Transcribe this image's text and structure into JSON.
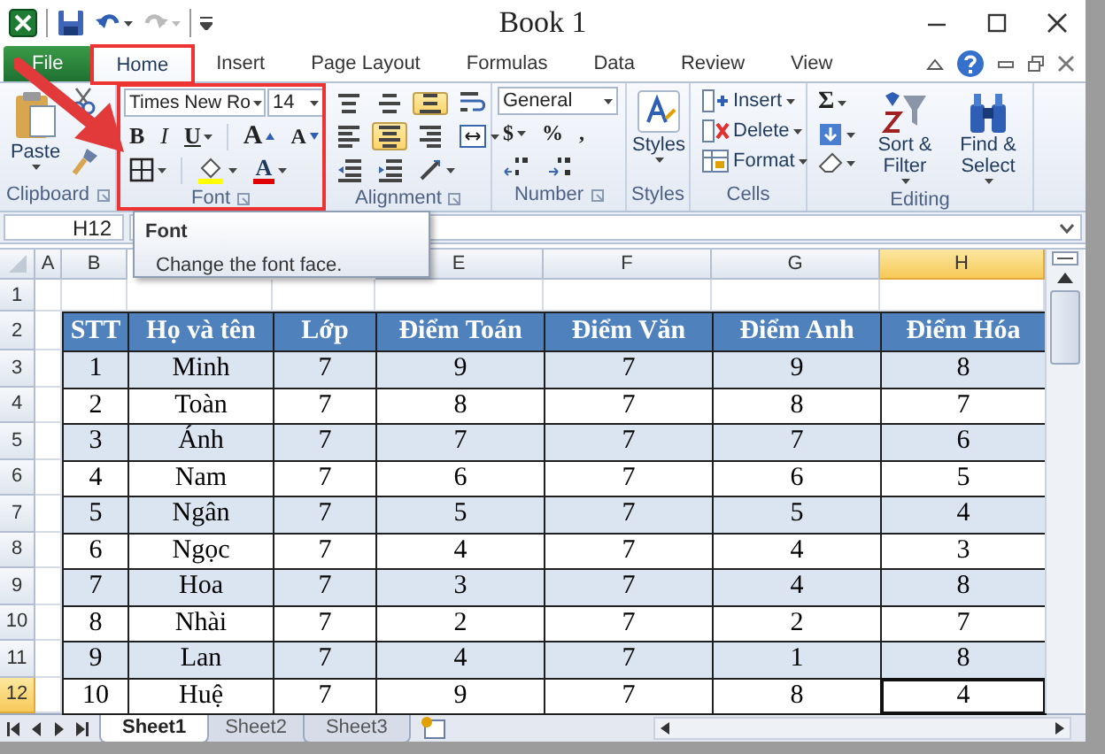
{
  "window": {
    "title": "Book 1"
  },
  "ribbon_tabs": [
    {
      "label": "File",
      "kind": "file",
      "selected": false,
      "highlighted": false
    },
    {
      "label": "Home",
      "kind": "tab",
      "selected": true,
      "highlighted": true
    },
    {
      "label": "Insert",
      "kind": "tab",
      "selected": false,
      "highlighted": false
    },
    {
      "label": "Page Layout",
      "kind": "tab",
      "selected": false,
      "highlighted": false
    },
    {
      "label": "Formulas",
      "kind": "tab",
      "selected": false,
      "highlighted": false
    },
    {
      "label": "Data",
      "kind": "tab",
      "selected": false,
      "highlighted": false
    },
    {
      "label": "Review",
      "kind": "tab",
      "selected": false,
      "highlighted": false
    },
    {
      "label": "View",
      "kind": "tab",
      "selected": false,
      "highlighted": false
    }
  ],
  "annotation_arrow": true,
  "ribbon": {
    "clipboard": {
      "label": "Clipboard",
      "paste": "Paste"
    },
    "font": {
      "label": "Font",
      "highlighted": true,
      "font_name": "Times New Ro",
      "font_size": "14",
      "bold": "B",
      "italic": "I",
      "underline": "U",
      "grow": "A",
      "shrink": "A",
      "font_color": "A"
    },
    "alignment": {
      "label": "Alignment",
      "vertical": [
        {
          "kind": "top",
          "selected": false
        },
        {
          "kind": "middle",
          "selected": false
        },
        {
          "kind": "bottom",
          "selected": true
        }
      ],
      "horizontal": [
        {
          "kind": "left",
          "selected": false
        },
        {
          "kind": "center",
          "selected": true
        },
        {
          "kind": "right",
          "selected": false
        }
      ]
    },
    "number": {
      "label": "Number",
      "format": "General",
      "currency": "$",
      "percent": "%",
      "comma": ","
    },
    "styles": {
      "label": "Styles",
      "button": "Styles"
    },
    "cells": {
      "label": "Cells",
      "buttons": [
        "Insert",
        "Delete",
        "Format"
      ]
    },
    "editing": {
      "label": "Editing",
      "sum": "Σ",
      "sort": "Sort & Filter",
      "find": "Find & Select"
    }
  },
  "name_box": "H12",
  "tooltip": {
    "title": "Font",
    "text": "Change the font face."
  },
  "columns": [
    {
      "kind": "letter",
      "label": "A",
      "selected": false
    },
    {
      "kind": "letter",
      "label": "B",
      "selected": false
    },
    {
      "kind": "covered"
    },
    {
      "kind": "covered"
    },
    {
      "kind": "letter",
      "label": "E",
      "selected": false
    },
    {
      "kind": "letter",
      "label": "F",
      "selected": false
    },
    {
      "kind": "letter",
      "label": "G",
      "selected": false
    },
    {
      "kind": "letter",
      "label": "H",
      "selected": true
    }
  ],
  "rows": [
    {
      "number": "1",
      "kind": "blank",
      "selected": false
    },
    {
      "number": "2",
      "kind": "header",
      "selected": false,
      "cells": [
        "STT",
        "Họ và tên",
        "Lớp",
        "Điểm Toán",
        "Điểm Văn",
        "Điểm Anh",
        "Điểm Hóa"
      ]
    },
    {
      "number": "3",
      "kind": "data",
      "shaded": true,
      "selected": false,
      "cells": [
        "1",
        "Minh",
        "7",
        "9",
        "7",
        "9",
        "8"
      ]
    },
    {
      "number": "4",
      "kind": "data",
      "shaded": false,
      "selected": false,
      "cells": [
        "2",
        "Toàn",
        "7",
        "8",
        "7",
        "8",
        "7"
      ]
    },
    {
      "number": "5",
      "kind": "data",
      "shaded": true,
      "selected": false,
      "cells": [
        "3",
        "Ánh",
        "7",
        "7",
        "7",
        "7",
        "6"
      ]
    },
    {
      "number": "6",
      "kind": "data",
      "shaded": false,
      "selected": false,
      "cells": [
        "4",
        "Nam",
        "7",
        "6",
        "7",
        "6",
        "5"
      ]
    },
    {
      "number": "7",
      "kind": "data",
      "shaded": true,
      "selected": false,
      "cells": [
        "5",
        "Ngân",
        "7",
        "5",
        "7",
        "5",
        "4"
      ]
    },
    {
      "number": "8",
      "kind": "data",
      "shaded": false,
      "selected": false,
      "cells": [
        "6",
        "Ngọc",
        "7",
        "4",
        "7",
        "4",
        "3"
      ]
    },
    {
      "number": "9",
      "kind": "data",
      "shaded": true,
      "selected": false,
      "cells": [
        "7",
        "Hoa",
        "7",
        "3",
        "7",
        "4",
        "8"
      ]
    },
    {
      "number": "10",
      "kind": "data",
      "shaded": false,
      "selected": false,
      "cells": [
        "8",
        "Nhài",
        "7",
        "2",
        "7",
        "2",
        "7"
      ]
    },
    {
      "number": "11",
      "kind": "data",
      "shaded": true,
      "selected": false,
      "cells": [
        "9",
        "Lan",
        "7",
        "4",
        "7",
        "1",
        "8"
      ]
    },
    {
      "number": "12",
      "kind": "data",
      "shaded": false,
      "selected": true,
      "cells": [
        "10",
        "Huệ",
        "7",
        "9",
        "7",
        "8",
        "4"
      ]
    }
  ],
  "sheet_tabs": [
    {
      "label": "Sheet1",
      "selected": true
    },
    {
      "label": "Sheet2",
      "selected": false
    },
    {
      "label": "Sheet3",
      "selected": false
    }
  ]
}
